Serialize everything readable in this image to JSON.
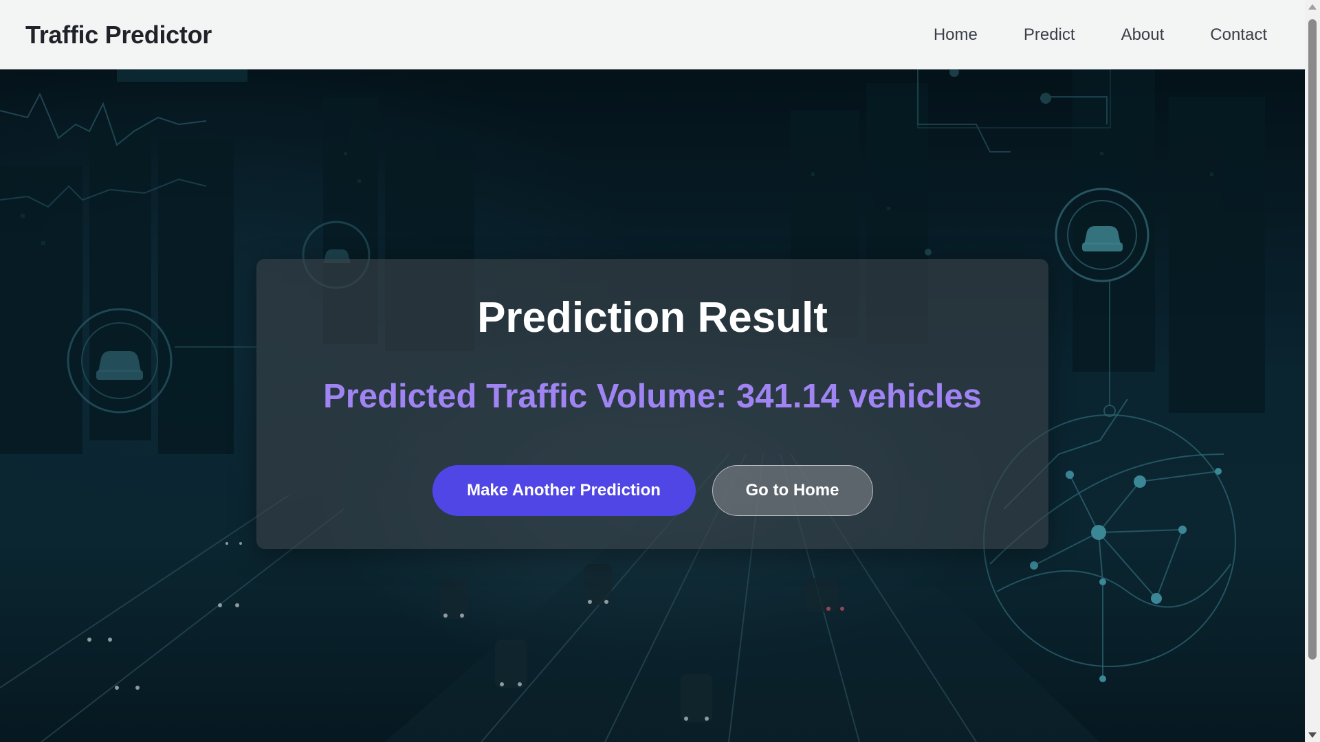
{
  "navbar": {
    "brand": "Traffic Predictor",
    "links": [
      "Home",
      "Predict",
      "About",
      "Contact"
    ]
  },
  "result": {
    "title": "Prediction Result",
    "prediction_text": "Predicted Traffic Volume: 341.14 vehicles",
    "primary_button": "Make Another Prediction",
    "secondary_button": "Go to Home"
  },
  "colors": {
    "nav_background": "#f3f4f4",
    "brand_text": "#1f2329",
    "accent_purple": "#a184f3",
    "primary_button": "#4f46e5",
    "hero_background": "#0a2430"
  },
  "icons": [
    "car-icon",
    "network-map-icon",
    "line-graph-decoration"
  ]
}
